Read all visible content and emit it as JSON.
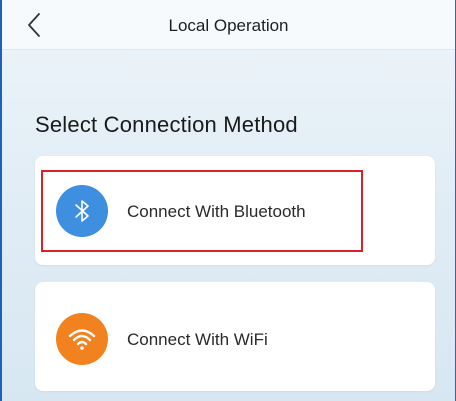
{
  "header": {
    "title": "Local Operation",
    "back_icon": "chevron-left-icon"
  },
  "main": {
    "heading": "Select Connection Method",
    "options": [
      {
        "label": "Connect With Bluetooth",
        "icon": "bluetooth-icon",
        "icon_color": "#3f8fe0",
        "highlighted": true,
        "highlight_color": "#d8232a"
      },
      {
        "label": "Connect With WiFi",
        "icon": "wifi-icon",
        "icon_color": "#f2821f",
        "highlighted": false
      }
    ]
  }
}
